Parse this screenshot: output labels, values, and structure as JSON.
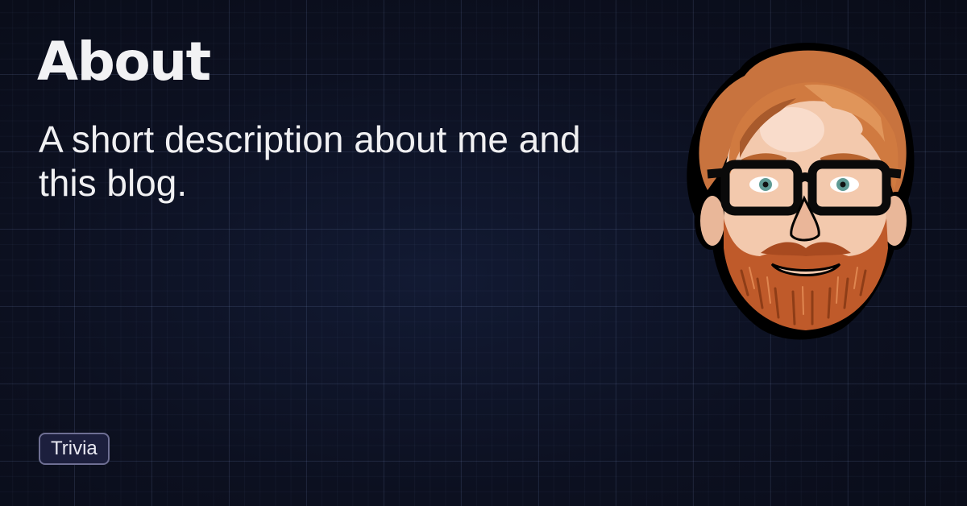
{
  "page": {
    "title": "About",
    "description": "A short description about me and this blog.",
    "tag": "Trivia"
  },
  "avatar": {
    "icon": "cartoon-face-icon",
    "colors": {
      "hair": "#c8733e",
      "beard": "#bf5a2a",
      "skin": "#f3c9ad",
      "glasses": "#0a0a0a",
      "eyes": "#5f9a94",
      "outline": "#000000"
    }
  },
  "theme": {
    "background": "#0c1020",
    "grid": "#2a3352",
    "text": "#f0f0f2",
    "tag_background": "#1c1f3d",
    "tag_border": "#6e6f93"
  }
}
